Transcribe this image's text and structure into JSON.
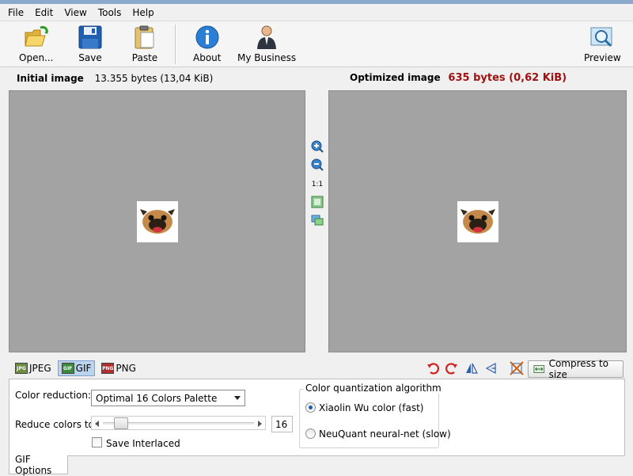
{
  "menu": [
    "File",
    "Edit",
    "View",
    "Tools",
    "Help"
  ],
  "toolbar": {
    "open_label": "Open...",
    "save_label": "Save",
    "paste_label": "Paste",
    "about_label": "About",
    "business_label": "My Business",
    "preview_label": "Preview"
  },
  "info": {
    "initial_label": "Initial image",
    "initial_size": "13.355 bytes (13,04 KiB)",
    "optimized_label": "Optimized image",
    "optimized_size": "635 bytes (0,62 KiB)"
  },
  "zoom": {
    "actual_size_label": "1:1"
  },
  "format_tabs": [
    "JPEG",
    "GIF",
    "PNG"
  ],
  "active_format": "GIF",
  "compress_label": "Compress to size",
  "options": {
    "color_reduction_label": "Color reduction:",
    "color_reduction_value": "Optimal 16 Colors Palette",
    "reduce_colors_label": "Reduce colors to:",
    "reduce_colors_value": "16",
    "save_interlaced_label": "Save Interlaced",
    "algorithm_group_label": "Color quantization algorithm",
    "algorithm_option_1": "Xiaolin Wu color (fast)",
    "algorithm_option_2": "NeuQuant neural-net (slow)",
    "selected_algorithm": "Xiaolin Wu color (fast)"
  },
  "panel_tab_label": "GIF Options",
  "colors": {
    "accent": "#a01010",
    "active_tab": "#bcd3ee",
    "canvas": "#a3a3a3"
  }
}
